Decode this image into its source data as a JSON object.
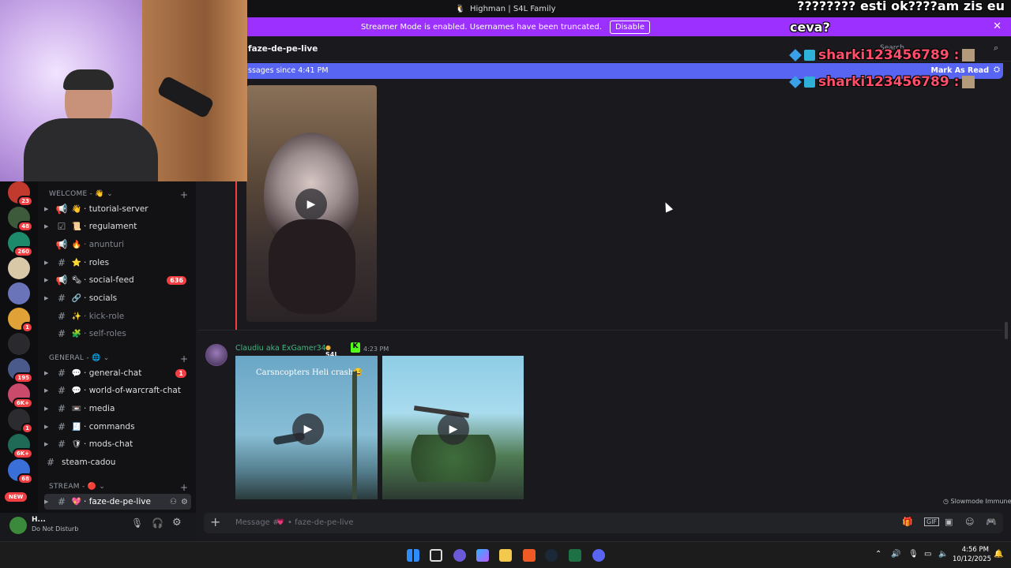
{
  "window": {
    "title": "Highman | S4L Family"
  },
  "streamer_banner": {
    "text": "Streamer Mode is enabled. Usernames have been truncated.",
    "button": "Disable",
    "close": "✕"
  },
  "channel_header": {
    "name": "faze-de-pe-live",
    "search": "Search"
  },
  "new_messages": {
    "text": "ssages since 4:41 PM",
    "mark_read": "Mark As Read"
  },
  "servers": [
    {
      "badge": "23"
    },
    {
      "badge": "48"
    },
    {
      "badge": "260"
    },
    {
      "badge": ""
    },
    {
      "badge": ""
    },
    {
      "badge": "1"
    },
    {
      "badge": ""
    },
    {
      "badge": "195"
    },
    {
      "badge": "6K+"
    },
    {
      "badge": "1"
    },
    {
      "badge": "6K+"
    },
    {
      "badge": "68"
    },
    {
      "badge": "NEW"
    }
  ],
  "categories": {
    "welcome": "WELCOME - 👋",
    "general": "GENERAL - 🌐",
    "stream": "STREAM - 🔴"
  },
  "channels": {
    "tutorial_server": {
      "emoji": "👋",
      "name": "tutorial-server"
    },
    "regulament": {
      "emoji": "📜",
      "name": "regulament"
    },
    "anunturi": {
      "emoji": "🔥",
      "name": "anunturi"
    },
    "roles": {
      "emoji": "⭐",
      "name": "roles"
    },
    "social_feed": {
      "emoji": "🗞",
      "name": "social-feed",
      "count": "636"
    },
    "socials": {
      "emoji": "🔗",
      "name": "socials"
    },
    "kick_role": {
      "emoji": "✨",
      "name": "kick-role"
    },
    "self_roles": {
      "emoji": "🧩",
      "name": "self-roles"
    },
    "general_chat": {
      "emoji": "💬",
      "name": "general-chat",
      "count": "1"
    },
    "wow_chat": {
      "emoji": "💬",
      "name": "world-of-warcraft-chat"
    },
    "media": {
      "emoji": "📼",
      "name": "media"
    },
    "commands": {
      "emoji": "🧾",
      "name": "commands"
    },
    "mods_chat": {
      "emoji": "🛡",
      "name": "mods-chat"
    },
    "steam_cadou": {
      "name": "steam-cadou"
    },
    "faze_de_pe_live": {
      "emoji": "💖",
      "name": "faze-de-pe-live"
    }
  },
  "user_panel": {
    "name": "H...",
    "status": "Do Not Disturb"
  },
  "message": {
    "author": "Claudiu aka ExGamer34",
    "tag": "S4L",
    "time": "4:23 PM",
    "video_caption": "Carsncopters Heli crash😂"
  },
  "composer": {
    "placeholder_prefix": "Message #",
    "placeholder_channel": "• faze-de-pe-live",
    "slowmode": "Slowmode Immune"
  },
  "overlay": {
    "line1": "???????? esti ok????am zis eu",
    "line2": "ceva?",
    "user1": "sharki123456789 :",
    "user2": "sharki123456789 :"
  },
  "taskbar": {
    "time": "4:56 PM",
    "date": "10/12/2025"
  },
  "colors": {
    "accent": "#5865f2",
    "streamer_banner": "#a020f0",
    "badge": "#f23f43",
    "username": "#43b581"
  }
}
